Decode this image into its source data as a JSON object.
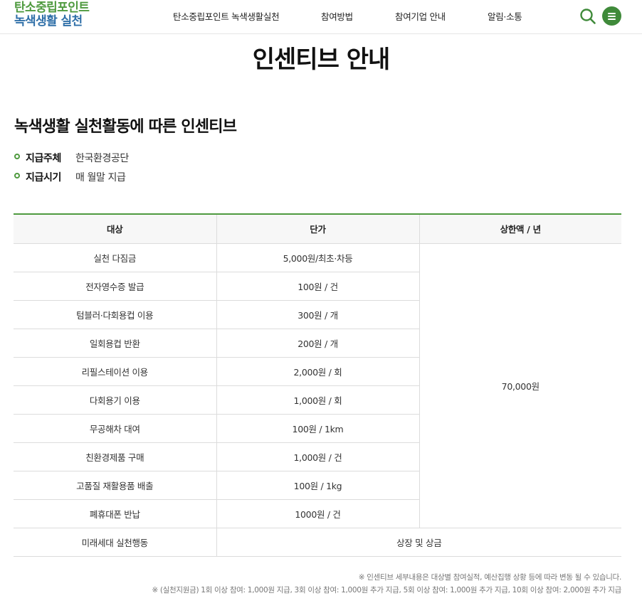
{
  "header": {
    "logo_line1": "탄소중립포인트",
    "logo_line2": "녹색생활 실천",
    "nav": [
      "탄소중립포인트 녹색생활실천",
      "참여방법",
      "참여기업 안내",
      "알림·소통"
    ],
    "icons": {
      "search": "search-icon",
      "menu": "hamburger-menu-icon"
    },
    "colors": {
      "brand_green": "#4f9a3f",
      "brand_blue": "#2f6fa8",
      "menu_button": "#3f8a3a"
    }
  },
  "page_title": "인센티브 안내",
  "section": {
    "title": "녹색생활 실천활동에 따른 인센티브",
    "info": [
      {
        "label": "지급주체",
        "value": "한국환경공단"
      },
      {
        "label": "지급시기",
        "value": "매 월말 지급"
      }
    ]
  },
  "table": {
    "headers": [
      "대상",
      "단가",
      "상한액 / 년"
    ],
    "rows": [
      {
        "target": "실천 다짐금",
        "price": "5,000원/최초·차등"
      },
      {
        "target": "전자영수증 발급",
        "price": "100원 / 건"
      },
      {
        "target": "텀블러·다회용컵 이용",
        "price": "300원 / 개"
      },
      {
        "target": "일회용컵 반환",
        "price": "200원 / 개"
      },
      {
        "target": "리필스테이션 이용",
        "price": "2,000원 / 회"
      },
      {
        "target": "다회용기 이용",
        "price": "1,000원 / 회"
      },
      {
        "target": "무공해차 대여",
        "price": "100원 / 1km"
      },
      {
        "target": "친환경제품 구매",
        "price": "1,000원 / 건"
      },
      {
        "target": "고품질 재활용품 배출",
        "price": "100원 / 1kg"
      },
      {
        "target": "폐휴대폰 반납",
        "price": "1000원 / 건"
      }
    ],
    "cap": "70,000원",
    "last_row": {
      "target": "미래세대 실천행동",
      "price": "상장 및 상금"
    }
  },
  "notes": [
    "※ 인센티브 세부내용은 대상별 참여실적, 예산집행 상황 등에 따라 변동 될 수 있습니다.",
    "※ (실천지원금) 1회 이상 참여: 1,000원 지급, 3회 이상 참여: 1,000원 추가 지급, 5회 이상 참여: 1,000원 추가 지급, 10회 이상 참여: 2,000원 추가 지급"
  ]
}
